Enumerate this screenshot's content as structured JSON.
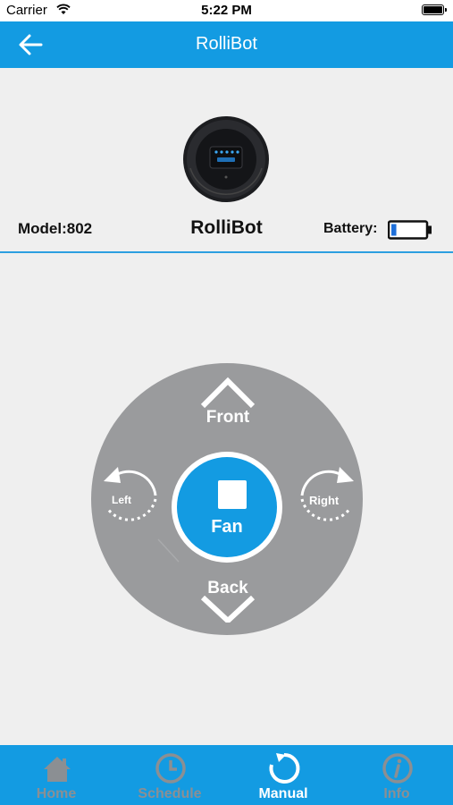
{
  "status_bar": {
    "carrier": "Carrier",
    "time": "5:22 PM",
    "wifi_icon": "wifi-icon",
    "battery_icon": "battery-icon"
  },
  "nav": {
    "title": "RolliBot",
    "back_icon": "arrow-left-icon"
  },
  "robot": {
    "model_label": "Model:802",
    "name": "RolliBot",
    "battery_label": "Battery:",
    "battery_level": 0.15,
    "image_icon": "robot-vacuum-icon"
  },
  "controls": {
    "front": "Front",
    "back": "Back",
    "left": "Left",
    "right": "Right",
    "fan": "Fan",
    "fan_icon": "stop-square-icon"
  },
  "tabs": [
    {
      "label": "Home",
      "icon": "home-icon",
      "active": false
    },
    {
      "label": "Schedule",
      "icon": "clock-icon",
      "active": false
    },
    {
      "label": "Manual",
      "icon": "refresh-icon",
      "active": true
    },
    {
      "label": "Info",
      "icon": "info-icon",
      "active": false
    }
  ],
  "colors": {
    "primary": "#139be2",
    "pad_gray": "#9a9b9d",
    "background": "#efefef",
    "inactive_tab": "#8b8f93",
    "battery_fill": "#1e6fd9"
  }
}
